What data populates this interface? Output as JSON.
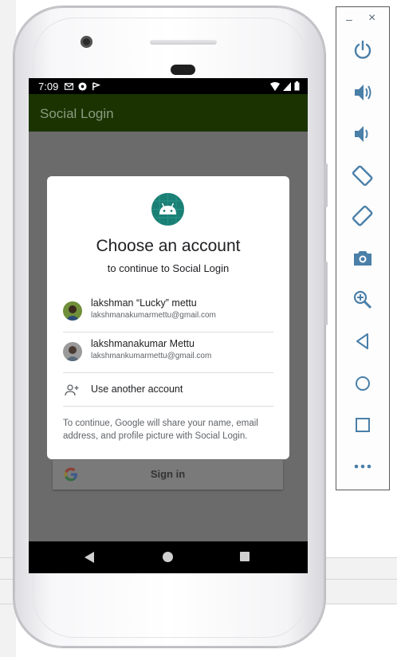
{
  "statusbar": {
    "time": "7:09"
  },
  "app": {
    "title": "Social Login"
  },
  "signin": {
    "label": "Sign in"
  },
  "dialog": {
    "title": "Choose an account",
    "subtitle": "to continue to Social Login",
    "accounts": [
      {
        "name": "lakshman “Lucky” mettu",
        "email": "lakshmanakumarmettu@gmail.com"
      },
      {
        "name": "lakshmanakumar Mettu",
        "email": "lakshmankumarmettu@gmail.com"
      }
    ],
    "use_another": "Use another account",
    "footer": "To continue, Google will share your name, email address, and profile picture with Social Login."
  },
  "toolbar": {
    "minimize": "–",
    "close": "×",
    "items": [
      "power-icon",
      "volume-up-icon",
      "volume-down-icon",
      "rotate-left-icon",
      "rotate-right-icon",
      "camera-icon",
      "zoom-icon",
      "back-icon",
      "home-icon",
      "overview-icon",
      "more-icon"
    ]
  },
  "colors": {
    "appbar": "#1a3300",
    "android_logo": "#1a7f75",
    "toolbar_icon": "#4a7fa8"
  }
}
